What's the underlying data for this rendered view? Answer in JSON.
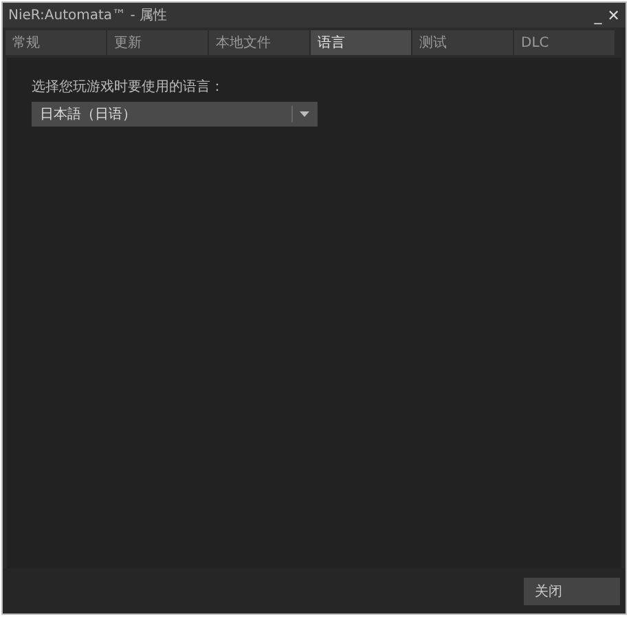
{
  "window": {
    "title": "NieR:Automata™ - 属性",
    "controls": [
      "_",
      "✕"
    ]
  },
  "tabs": [
    {
      "label": "常规",
      "selected": false
    },
    {
      "label": "更新",
      "selected": false
    },
    {
      "label": "本地文件",
      "selected": false
    },
    {
      "label": "语言",
      "selected": true
    },
    {
      "label": "测试",
      "selected": false
    },
    {
      "label": "DLC",
      "selected": false
    }
  ],
  "language": {
    "label": "选择您玩游戏时要使用的语言：",
    "value": "日本語（日语）"
  },
  "buttons": [
    "关闭"
  ]
}
